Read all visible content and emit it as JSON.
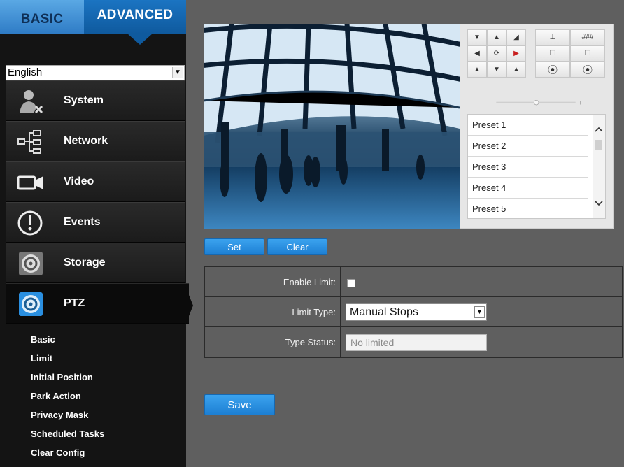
{
  "tabs": {
    "basic": "BASIC",
    "advanced": "ADVANCED"
  },
  "language": {
    "selected": "English"
  },
  "menu": [
    {
      "label": "System",
      "icon": "system-user-icon"
    },
    {
      "label": "Network",
      "icon": "network-icon"
    },
    {
      "label": "Video",
      "icon": "video-camera-icon"
    },
    {
      "label": "Events",
      "icon": "events-exclamation-icon"
    },
    {
      "label": "Storage",
      "icon": "storage-disk-icon"
    },
    {
      "label": "PTZ",
      "icon": "ptz-icon"
    }
  ],
  "ptz_submenu": [
    "Basic",
    "Limit",
    "Initial Position",
    "Park Action",
    "Privacy Mask",
    "Scheduled Tasks",
    "Clear Config"
  ],
  "presets": [
    "Preset 1",
    "Preset 2",
    "Preset 3",
    "Preset 4",
    "Preset 5"
  ],
  "buttons": {
    "set": "Set",
    "clear": "Clear",
    "save": "Save"
  },
  "form": {
    "enable_limit_label": "Enable Limit:",
    "enable_limit_checked": false,
    "limit_type_label": "Limit Type:",
    "limit_type_value": "Manual Stops",
    "type_status_label": "Type Status:",
    "type_status_placeholder": "No limited"
  },
  "colors": {
    "accent": "#1d7fd3",
    "sidebar": "#141414",
    "background": "#5f5f5f"
  }
}
